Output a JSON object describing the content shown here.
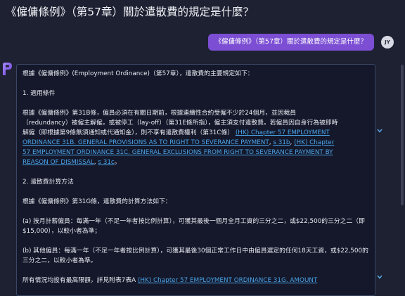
{
  "page": {
    "title": "《僱傭條例》（第57章）關於遣散費的規定是什麼？"
  },
  "user": {
    "question": "《僱傭條例》（第57章）關於遣散費的規定是什麼？",
    "avatar_initials": "JY"
  },
  "answer": {
    "intro": "根據《僱傭條例》(Employment Ordinance)（第57章），遣散費的主要規定如下：",
    "section1_heading": "1. 適用條件",
    "section1_text": "根據《僱傭條例》第31B條，僱員必須在有關日期前，根據連續性合約受僱不少於24個月，並因裁員（redundancy）被僱主解僱，或被停工（lay-off）（第31E條所指），僱主須支付遣散費。若僱員因自身行為被即時解僱（即根據第9條無須通知或代通知金），則不享有遣散費權利（第31C條）",
    "section1_link1": "(HK) Chapter 57 EMPLOYMENT ORDINANCE 31B. GENERAL PROVISIONS AS TO RIGHT TO SEVERANCE PAYMENT",
    "section1_link2": "s 31b",
    "section1_link3": "(HK) Chapter 57 EMPLOYMENT ORDINANCE 31C. GENERAL EXCLUSIONS FROM RIGHT TO SEVERANCE PAYMENT BY REASON OF DISMISSAL",
    "section1_link4": "s 31c",
    "comma": ", ",
    "section1_end": "。",
    "section2_heading": "2. 遣散費計算方法",
    "section2_intro": "根據《僱傭條例》第31G條，遣散費的計算方法如下：",
    "item_a": "(a) 按月計薪僱員：每滿一年（不足一年者按比例計算），可獲其最後一個月全月工資的三分之二，或$22,500的三分之二（即$15,000），以較小者為準；",
    "item_b": "(b) 其他僱員：每滿一年（不足一年者按比例計算），可獲其最後30個正常工作日中由僱員選定的任何18天工資，或$22,500的三分之二，以較小者為準。",
    "final_text": "所有情況均設有最高限額，詳見附表7表A",
    "final_link": "(HK) Chapter 57 EMPLOYMENT ORDINANCE 31G. AMOUNT"
  },
  "colors": {
    "background": "#1d2132",
    "user_bubble": "#7b4ed3",
    "panel": "#14182a",
    "link": "#4aa3e8"
  },
  "icons": [
    "bot-logo-icon",
    "chevron-down-icon"
  ]
}
